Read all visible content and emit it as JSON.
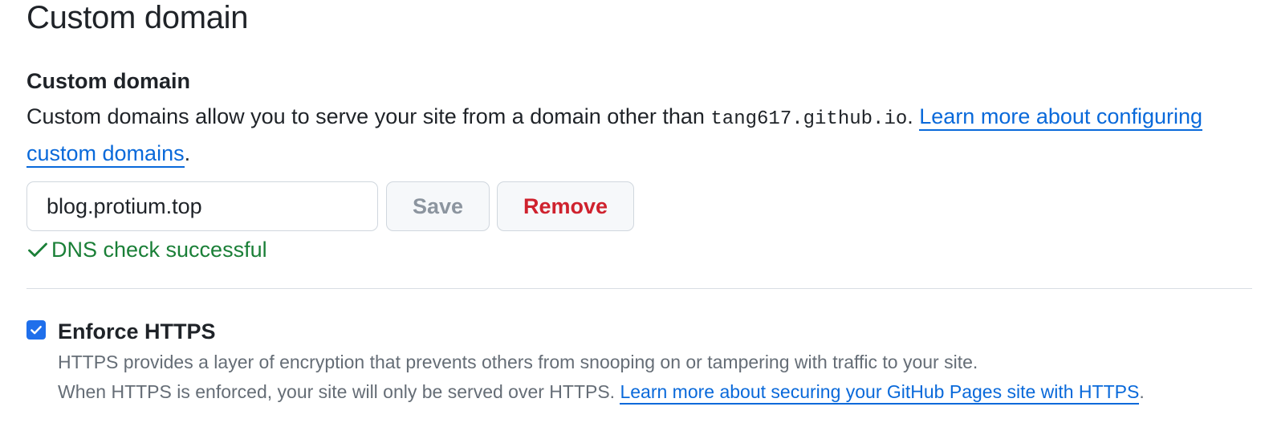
{
  "section_title": "Custom domain",
  "custom_domain": {
    "label": "Custom domain",
    "description_prefix": "Custom domains allow you to serve your site from a domain other than ",
    "default_domain": "tang617.github.io",
    "description_mid": ". ",
    "learn_more_link": "Learn more about configuring custom domains",
    "description_suffix": ".",
    "input_value": "blog.protium.top",
    "save_label": "Save",
    "remove_label": "Remove",
    "dns_status": "DNS check successful"
  },
  "enforce_https": {
    "checked": true,
    "label": "Enforce HTTPS",
    "note_line1": "HTTPS provides a layer of encryption that prevents others from snooping on or tampering with traffic to your site.",
    "note_line2_prefix": "When HTTPS is enforced, your site will only be served over HTTPS. ",
    "learn_more_link": "Learn more about securing your GitHub Pages site with HTTPS",
    "note_line2_suffix": "."
  },
  "colors": {
    "link": "#0969da",
    "success": "#1a7f37",
    "danger": "#cf222e",
    "checkbox": "#1f6feb"
  },
  "icons": {
    "dns_status": "check-icon",
    "checkbox_mark": "checkmark-icon"
  }
}
